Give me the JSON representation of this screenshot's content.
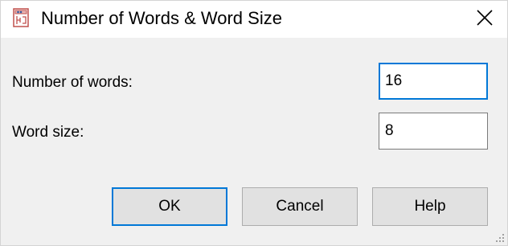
{
  "window": {
    "title": "Number of Words & Word Size",
    "app_icon": "quartus-app-icon",
    "close_icon": "close-icon"
  },
  "form": {
    "num_words": {
      "label": "Number of words:",
      "value": "16",
      "focused": true
    },
    "word_size": {
      "label": "Word size:",
      "value": "8"
    }
  },
  "buttons": {
    "ok": "OK",
    "cancel": "Cancel",
    "help": "Help"
  },
  "colors": {
    "accent": "#0078d7",
    "dialog_bg": "#f0f0f0",
    "button_bg": "#e1e1e1"
  }
}
